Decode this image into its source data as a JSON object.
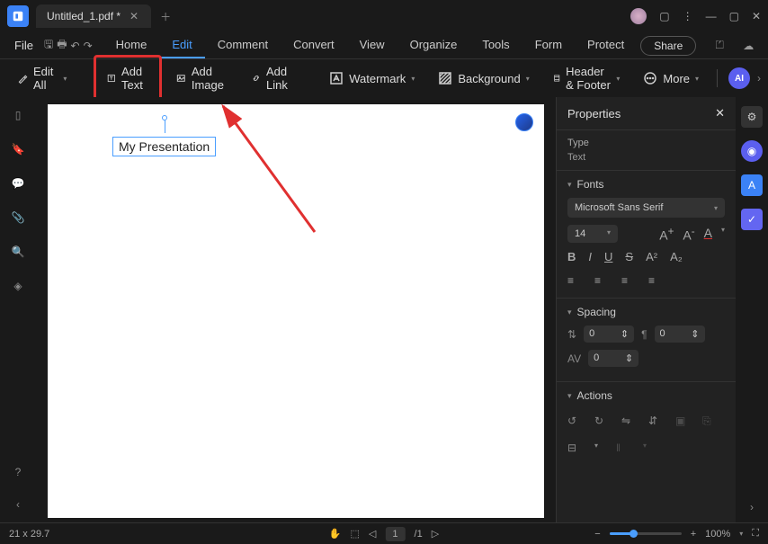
{
  "titlebar": {
    "tab_name": "Untitled_1.pdf *"
  },
  "menubar": {
    "file": "File",
    "tabs": [
      "Home",
      "Edit",
      "Comment",
      "Convert",
      "View",
      "Organize",
      "Tools",
      "Form",
      "Protect"
    ],
    "active_index": 1,
    "share": "Share"
  },
  "toolbar": {
    "edit_all": "Edit All",
    "add_text": "Add Text",
    "add_image": "Add Image",
    "add_link": "Add Link",
    "watermark": "Watermark",
    "background": "Background",
    "header_footer": "Header & Footer",
    "more": "More",
    "ai": "AI"
  },
  "document": {
    "text_content": "My Presentation"
  },
  "properties": {
    "title": "Properties",
    "type_label": "Type",
    "type_value": "Text",
    "fonts_label": "Fonts",
    "font_family": "Microsoft Sans Serif",
    "font_size": "14",
    "spacing_label": "Spacing",
    "line_spacing": "0",
    "para_spacing": "0",
    "char_spacing": "0",
    "actions_label": "Actions"
  },
  "statusbar": {
    "dimensions": "21 x 29.7",
    "page_current": "1",
    "page_total": "/1",
    "zoom": "100%"
  }
}
